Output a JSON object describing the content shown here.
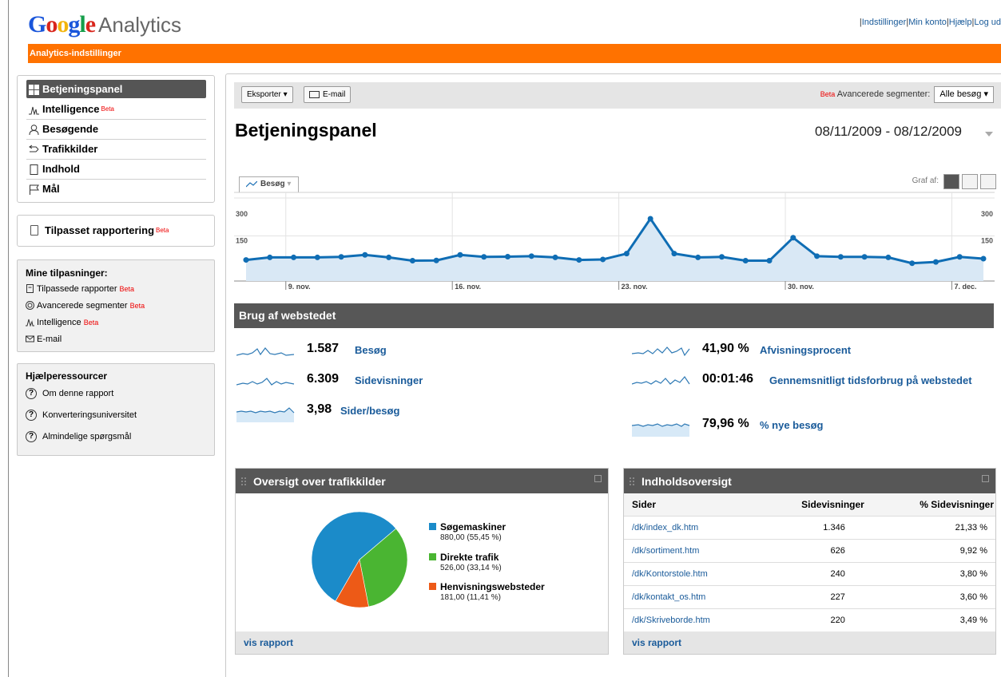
{
  "header": {
    "logo_letters": [
      "G",
      "o",
      "o",
      "g",
      "l",
      "e"
    ],
    "logo_colors": [
      "#1a56db",
      "#d9261c",
      "#f2b50f",
      "#1a56db",
      "#159e4a",
      "#d9261c"
    ],
    "analytics": "Analytics",
    "links": [
      "Indstillinger",
      "Min konto",
      "Hjælp",
      "Log ud"
    ],
    "orange_bar": "Analytics-indstillinger",
    "orange": "#ff7200"
  },
  "sidebar": {
    "nav": [
      {
        "label": "Betjeningspanel",
        "icon": "dashboard-icon",
        "active": true,
        "beta": ""
      },
      {
        "label": "Intelligence",
        "icon": "intelligence-icon",
        "active": false,
        "beta": "Beta"
      },
      {
        "label": "Besøgende",
        "icon": "visitor-icon",
        "active": false,
        "beta": ""
      },
      {
        "label": "Trafikkilder",
        "icon": "traffic-icon",
        "active": false,
        "beta": ""
      },
      {
        "label": "Indhold",
        "icon": "content-icon",
        "active": false,
        "beta": ""
      },
      {
        "label": "Mål",
        "icon": "flag-icon",
        "active": false,
        "beta": ""
      }
    ],
    "custom_reporting": {
      "label": "Tilpasset rapportering",
      "beta": "Beta"
    },
    "mine": {
      "title": "Mine tilpasninger:",
      "items": [
        {
          "label": "Tilpassede rapporter",
          "beta": "Beta",
          "icon": "report-icon"
        },
        {
          "label": "Avancerede segmenter",
          "beta": "Beta",
          "icon": "segment-icon"
        },
        {
          "label": "Intelligence",
          "beta": "Beta",
          "icon": "intelligence-icon"
        },
        {
          "label": "E-mail",
          "beta": "",
          "icon": "email-icon"
        }
      ]
    },
    "help": {
      "title": "Hjælperessourcer",
      "items": [
        "Om denne rapport",
        "Konverteringsuniversitet",
        "Almindelige spørgsmål"
      ]
    }
  },
  "toolbar": {
    "export": "Eksporter",
    "email": "E-mail",
    "beta": "Beta",
    "segments_label": "Avancerede segmenter:",
    "segments_value": "Alle besøg"
  },
  "main": {
    "title": "Betjeningspanel",
    "date_range": "08/11/2009 - 08/12/2009",
    "chart_tab": "Besøg",
    "graf_af": "Graf af:"
  },
  "chart_data": {
    "type": "area",
    "series": [
      {
        "name": "Besøg",
        "values": [
          55,
          65,
          65,
          65,
          67,
          75,
          65,
          52,
          53,
          75,
          67,
          68,
          70,
          65,
          55,
          57,
          80,
          218,
          80,
          65,
          67,
          52,
          52,
          143,
          70,
          67,
          67,
          65,
          42,
          47,
          67,
          60
        ]
      }
    ],
    "x_tick_labels": [
      "9. nov.",
      "16. nov.",
      "23. nov.",
      "30. nov.",
      "7. dec."
    ],
    "x_tick_index": [
      1,
      8,
      15,
      22,
      29
    ],
    "y_ticks": [
      150,
      300
    ],
    "ylim": [
      0,
      300
    ],
    "color": "#0f6db4",
    "fill": "#d9e8f5"
  },
  "usage": {
    "title": "Brug af webstedet",
    "metrics": [
      {
        "value": "1.587",
        "label": "Besøg"
      },
      {
        "value": "6.309",
        "label": "Sidevisninger"
      },
      {
        "value": "3,98",
        "label": "Sider/besøg"
      },
      {
        "value": "41,90 %",
        "label": "Afvisningsprocent"
      },
      {
        "value": "00:01:46",
        "label": "Gennemsnitligt tidsforbrug på webstedet"
      },
      {
        "value": "79,96 %",
        "label": "% nye besøg"
      }
    ]
  },
  "traffic": {
    "title": "Oversigt over trafikkilder",
    "footer": "vis rapport",
    "slices": [
      {
        "name": "Søgemaskiner",
        "value": "880,00 (55,45 %)",
        "pct": 55.45,
        "color": "#1b8bc9"
      },
      {
        "name": "Direkte trafik",
        "value": "526,00 (33,14 %)",
        "pct": 33.14,
        "color": "#4ab532"
      },
      {
        "name": "Henvisningswebsteder",
        "value": "181,00 (11,41 %)",
        "pct": 11.41,
        "color": "#ed5a17"
      }
    ]
  },
  "content": {
    "title": "Indholdsoversigt",
    "footer": "vis rapport",
    "columns": [
      "Sider",
      "Sidevisninger",
      "% Sidevisninger"
    ],
    "rows": [
      [
        "/dk/index_dk.htm",
        "1.346",
        "21,33 %"
      ],
      [
        "/dk/sortiment.htm",
        "626",
        "9,92 %"
      ],
      [
        "/dk/Kontorstole.htm",
        "240",
        "3,80 %"
      ],
      [
        "/dk/kontakt_os.htm",
        "227",
        "3,60 %"
      ],
      [
        "/dk/Skriveborde.htm",
        "220",
        "3,49 %"
      ]
    ]
  }
}
